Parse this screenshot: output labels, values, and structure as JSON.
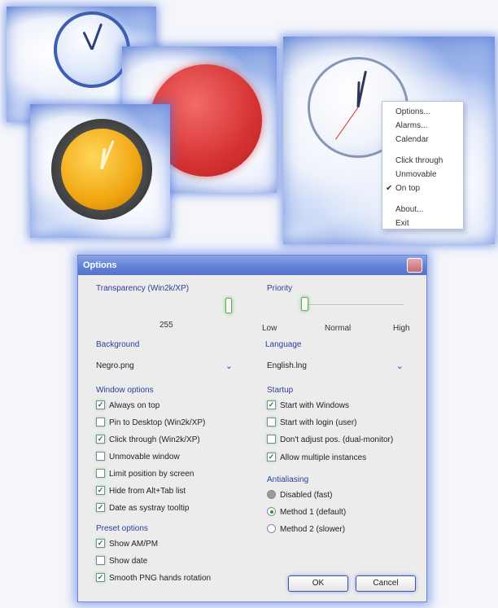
{
  "context_menu": {
    "items": [
      {
        "label": "Options...",
        "checked": false
      },
      {
        "label": "Alarms...",
        "checked": false
      },
      {
        "label": "Calendar",
        "checked": false
      },
      {
        "label": "Click through",
        "checked": false
      },
      {
        "label": "Unmovable",
        "checked": false
      },
      {
        "label": "On top",
        "checked": true
      },
      {
        "label": "About...",
        "checked": false
      },
      {
        "label": "Exit",
        "checked": false
      }
    ]
  },
  "dialog": {
    "title": "Options",
    "transparency": {
      "label": "Transparency (Win2k/XP)",
      "value": "255"
    },
    "priority": {
      "label": "Priority",
      "low": "Low",
      "normal": "Normal",
      "high": "High"
    },
    "background": {
      "label": "Background",
      "value": "Negro.png"
    },
    "language": {
      "label": "Language",
      "value": "English.lng"
    },
    "window_options": {
      "label": "Window options",
      "items": [
        {
          "label": "Always on top",
          "checked": true
        },
        {
          "label": "Pin to Desktop (Win2k/XP)",
          "checked": false
        },
        {
          "label": "Click through (Win2k/XP)",
          "checked": true
        },
        {
          "label": "Unmovable window",
          "checked": false
        },
        {
          "label": "Limit position by screen",
          "checked": false
        },
        {
          "label": "Hide from Alt+Tab list",
          "checked": true
        },
        {
          "label": "Date as systray tooltip",
          "checked": true
        }
      ]
    },
    "preset_options": {
      "label": "Preset options",
      "items": [
        {
          "label": "Show AM/PM",
          "checked": true
        },
        {
          "label": "Show date",
          "checked": false
        },
        {
          "label": "Smooth PNG hands rotation",
          "checked": true
        }
      ]
    },
    "startup": {
      "label": "Startup",
      "items": [
        {
          "label": "Start with Windows",
          "checked": true
        },
        {
          "label": "Start with login (user)",
          "checked": false
        },
        {
          "label": "Don't adjust pos. (dual-monitor)",
          "checked": false
        },
        {
          "label": "Allow multiple instances",
          "checked": true
        }
      ]
    },
    "antialiasing": {
      "label": "Antialiasing",
      "options": [
        {
          "label": "Disabled (fast)",
          "state": "disabled"
        },
        {
          "label": "Method 1 (default)",
          "state": "selected"
        },
        {
          "label": "Method 2 (slower)",
          "state": "unselected"
        }
      ]
    },
    "ok_label": "OK",
    "cancel_label": "Cancel"
  }
}
